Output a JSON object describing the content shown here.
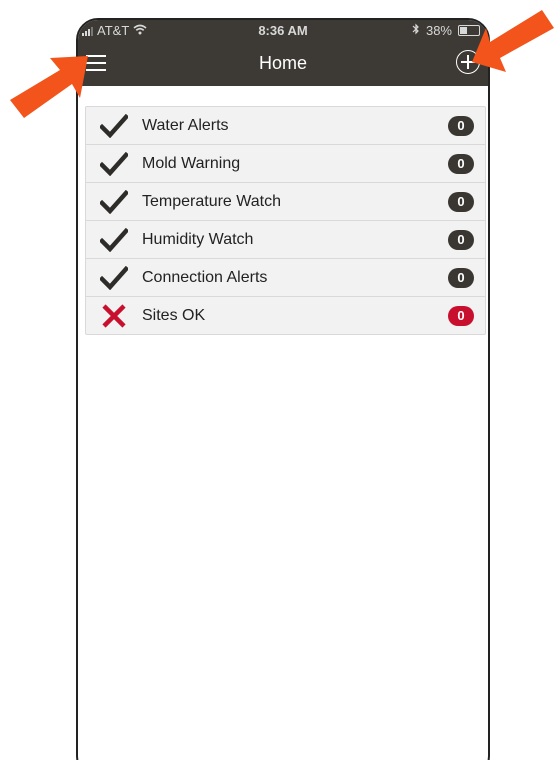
{
  "status_bar": {
    "carrier": "AT&T",
    "time": "8:36 AM",
    "battery": "38%"
  },
  "navbar": {
    "title": "Home",
    "menu_icon": "hamburger-menu-icon",
    "add_icon": "plus-circle-icon"
  },
  "items": [
    {
      "label": "Water Alerts",
      "count": "0",
      "status": "ok"
    },
    {
      "label": "Mold Warning",
      "count": "0",
      "status": "ok"
    },
    {
      "label": "Temperature Watch",
      "count": "0",
      "status": "ok"
    },
    {
      "label": "Humidity Watch",
      "count": "0",
      "status": "ok"
    },
    {
      "label": "Connection Alerts",
      "count": "0",
      "status": "ok"
    },
    {
      "label": "Sites OK",
      "count": "0",
      "status": "error"
    }
  ],
  "colors": {
    "navbar": "#3d3a35",
    "badge_ok": "#3a3733",
    "badge_error": "#c8102e",
    "check": "#2e2c29",
    "cross": "#c8102e",
    "arrow": "#f2541b"
  }
}
